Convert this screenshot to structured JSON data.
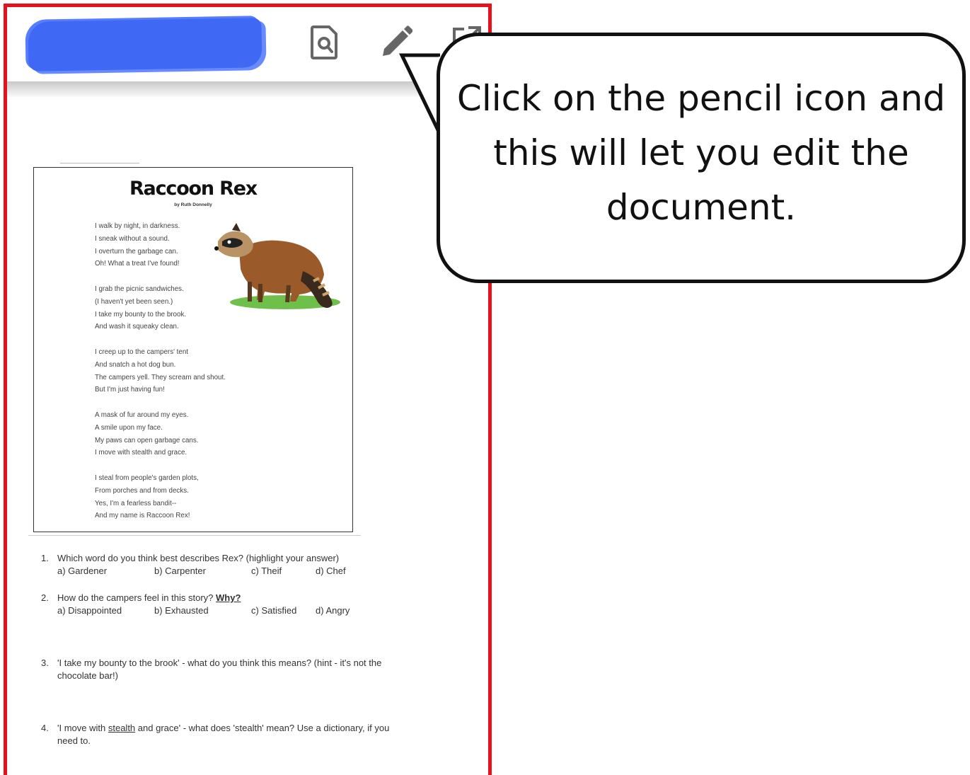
{
  "toolbar": {
    "preview_icon": "document-search-icon",
    "edit_icon": "pencil-icon",
    "open_icon": "open-in-new-icon"
  },
  "callout": {
    "lines": [
      "Click on the pencil icon and",
      "this will let you edit the",
      "document."
    ]
  },
  "poem": {
    "title": "Raccoon Rex",
    "author": "by Ruth Donnelly",
    "stanzas": [
      [
        "I walk by night, in darkness.",
        "I sneak without a sound.",
        "I overturn the garbage can.",
        "Oh! What a treat I've found!"
      ],
      [
        "I grab the picnic sandwiches.",
        "(I haven't yet been seen.)",
        "I take my bounty to the brook.",
        "And wash it squeaky clean."
      ],
      [
        "I creep up to the campers' tent",
        "And snatch a hot dog bun.",
        "The campers yell. They scream and shout.",
        "But I'm just having fun!"
      ],
      [
        "A mask of fur around my eyes.",
        "A smile upon my face.",
        "My paws can open garbage cans.",
        "I move with stealth and grace."
      ],
      [
        "I steal from people's garden plots,",
        "From porches and from decks.",
        "Yes, I'm a fearless bandit--",
        "And my name is Raccoon Rex!"
      ]
    ]
  },
  "questions": {
    "q1": {
      "num": "1.",
      "text": "Which word do you think best describes Rex? (highlight your answer)",
      "options": [
        "a) Gardener",
        "b) Carpenter",
        "c) Theif",
        "d) Chef"
      ]
    },
    "q2": {
      "num": "2.",
      "text": "How do the campers feel in this story?",
      "why": "Why?",
      "options": [
        "a) Disappointed",
        "b) Exhausted",
        "c) Satisfied",
        "d) Angry"
      ]
    },
    "q3": {
      "num": "3.",
      "line1": "'I take my bounty to the brook' - what do you think this means? (hint - it's not the",
      "line2": "chocolate bar!)"
    },
    "q4": {
      "num": "4.",
      "pre": "'I move with",
      "word": "stealth",
      "post": "and grace' - what does 'stealth' mean? Use a dictionary, if you",
      "line2": "need to."
    }
  }
}
